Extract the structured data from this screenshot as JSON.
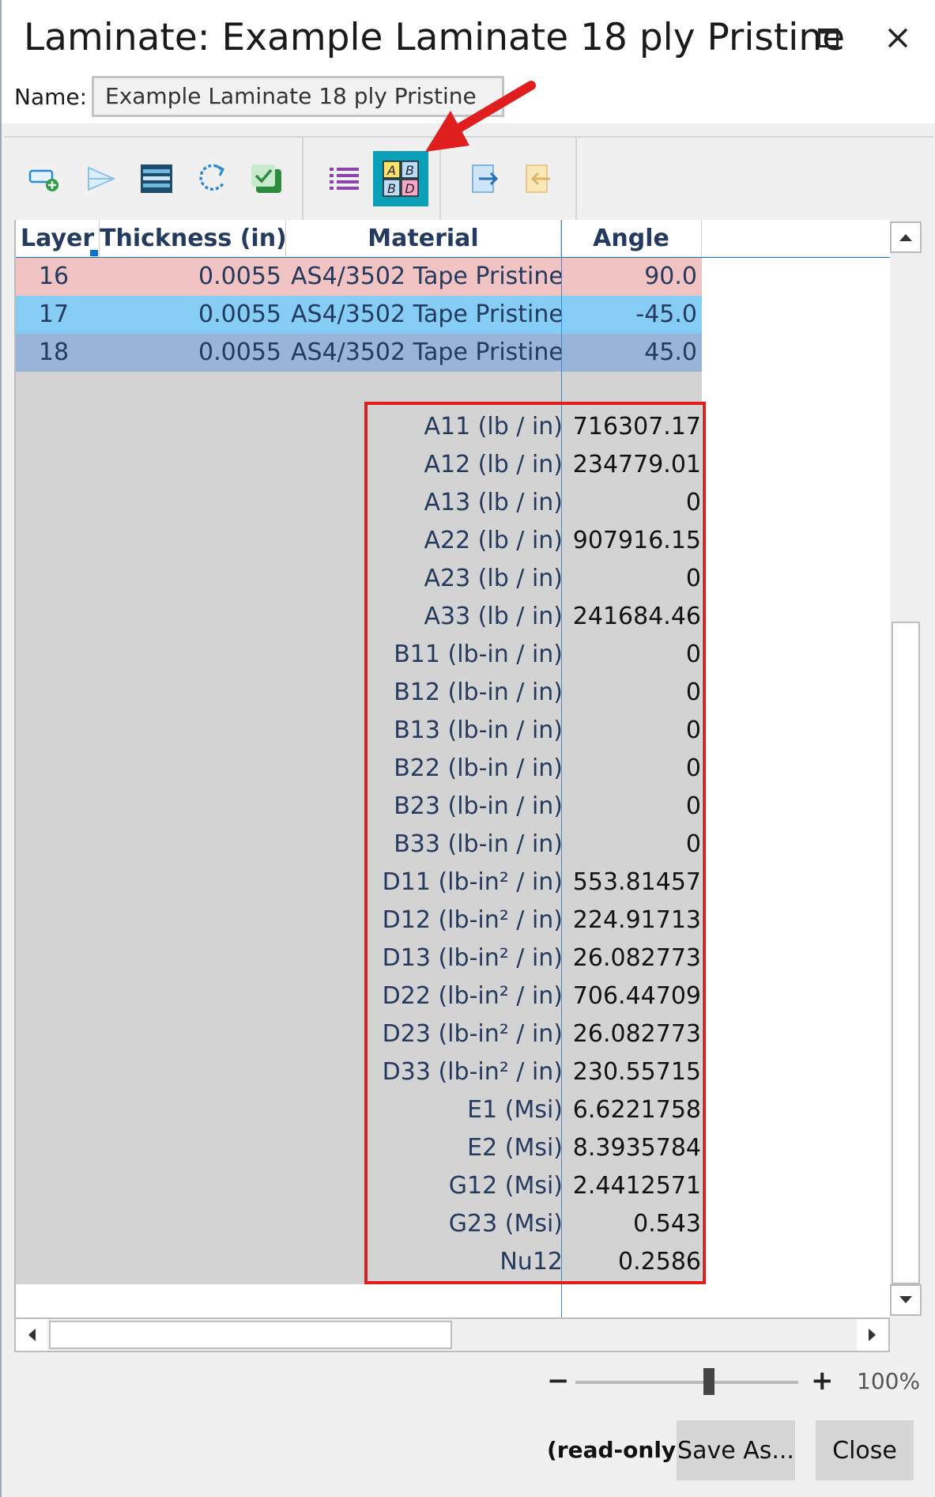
{
  "window": {
    "title": "Laminate: Example Laminate 18 ply Pristine"
  },
  "name_field": {
    "label": "Name:",
    "value": "Example Laminate 18 ply Pristine"
  },
  "toolbar": {
    "buttons": [
      {
        "icon": "add-layer-icon"
      },
      {
        "icon": "play-forward-icon"
      },
      {
        "icon": "layers-stack-icon"
      },
      {
        "icon": "refresh-icon"
      },
      {
        "icon": "check-icon"
      },
      {
        "icon": "list-icon"
      },
      {
        "icon": "abd-matrix-icon",
        "active": true
      },
      {
        "icon": "export-icon"
      },
      {
        "icon": "import-icon"
      }
    ]
  },
  "grid": {
    "columns": [
      "Layer",
      "Thickness (in)",
      "Material",
      "Angle"
    ],
    "rows": [
      {
        "layer": "16",
        "thickness": "0.0055",
        "material": "AS4/3502 Tape Pristine",
        "angle": "90.0",
        "color": "#f2c3c3"
      },
      {
        "layer": "17",
        "thickness": "0.0055",
        "material": "AS4/3502 Tape Pristine",
        "angle": "-45.0",
        "color": "#86cdf5"
      },
      {
        "layer": "18",
        "thickness": "0.0055",
        "material": "AS4/3502 Tape Pristine",
        "angle": "45.0",
        "color": "#98b4d9"
      }
    ],
    "properties": [
      {
        "name": "A11 (lb / in)",
        "value": "716307.17"
      },
      {
        "name": "A12 (lb / in)",
        "value": "234779.01"
      },
      {
        "name": "A13 (lb / in)",
        "value": "0"
      },
      {
        "name": "A22 (lb / in)",
        "value": "907916.15"
      },
      {
        "name": "A23 (lb / in)",
        "value": "0"
      },
      {
        "name": "A33 (lb / in)",
        "value": "241684.46"
      },
      {
        "name": "B11 (lb-in / in)",
        "value": "0"
      },
      {
        "name": "B12 (lb-in / in)",
        "value": "0"
      },
      {
        "name": "B13 (lb-in / in)",
        "value": "0"
      },
      {
        "name": "B22 (lb-in / in)",
        "value": "0"
      },
      {
        "name": "B23 (lb-in / in)",
        "value": "0"
      },
      {
        "name": "B33 (lb-in / in)",
        "value": "0"
      },
      {
        "name": "D11 (lb-in² / in)",
        "value": "553.81457"
      },
      {
        "name": "D12 (lb-in² / in)",
        "value": "224.91713"
      },
      {
        "name": "D13 (lb-in² / in)",
        "value": "26.082773"
      },
      {
        "name": "D22 (lb-in² / in)",
        "value": "706.44709"
      },
      {
        "name": "D23 (lb-in² / in)",
        "value": "26.082773"
      },
      {
        "name": "D33 (lb-in² / in)",
        "value": "230.55715"
      },
      {
        "name": "E1 (Msi)",
        "value": "6.6221758"
      },
      {
        "name": "E2 (Msi)",
        "value": "8.3935784"
      },
      {
        "name": "G12 (Msi)",
        "value": "2.4412571"
      },
      {
        "name": "G23 (Msi)",
        "value": "0.543"
      },
      {
        "name": "Nu12",
        "value": "0.2586"
      }
    ]
  },
  "zoom": {
    "minus": "−",
    "plus": "+",
    "percent": "100%",
    "level": 0.6
  },
  "footer": {
    "status": "(read-only)",
    "save_as_label": "Save As...",
    "close_label": "Close"
  },
  "colors": {
    "accent": "#0c9fb8",
    "highlight_box": "#e01e1e",
    "annotation_arrow": "#e01e1e"
  }
}
